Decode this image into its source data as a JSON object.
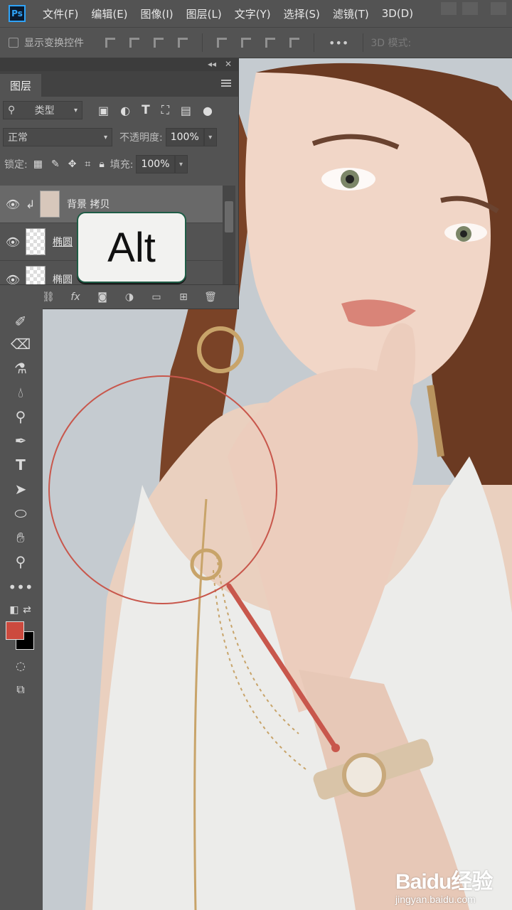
{
  "menubar": {
    "logo": "Ps",
    "items": [
      "文件(F)",
      "编辑(E)",
      "图像(I)",
      "图层(L)",
      "文字(Y)",
      "选择(S)",
      "滤镜(T)",
      "3D(D)"
    ]
  },
  "options": {
    "show_transform": "显示变换控件",
    "mode_3d": "3D 模式:",
    "more": "•••"
  },
  "panel": {
    "collapse": "◂◂",
    "close": "✕",
    "tab": "图层",
    "filter_type": "类型",
    "blend_mode": "正常",
    "opacity_label": "不透明度:",
    "opacity_value": "100%",
    "lock_label": "锁定:",
    "fill_label": "填充:",
    "fill_value": "100%",
    "layers": [
      {
        "name": "背景 拷贝",
        "selected": true
      },
      {
        "name": "椭圆",
        "selected": false
      },
      {
        "name": "椭圆",
        "selected": false
      }
    ]
  },
  "overlay": {
    "key_label": "Alt"
  },
  "colors": {
    "foreground": "#cc4a3e",
    "background": "#000000"
  },
  "watermark": {
    "brand": "Baidu经验",
    "url": "jingyan.baidu.com"
  }
}
